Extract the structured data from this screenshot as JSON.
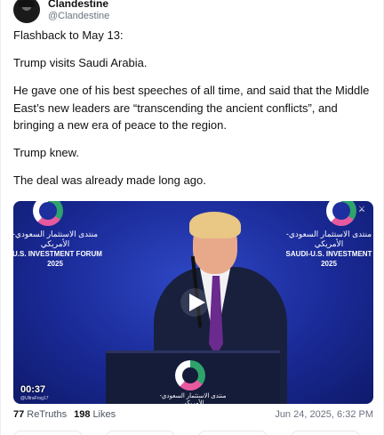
{
  "post": {
    "author": {
      "display_name": "Clandestine",
      "handle": "@Clandestine"
    },
    "paragraphs": [
      "Flashback to May 13:",
      "Trump visits Saudi Arabia.",
      "He gave one of his best speeches of all time, and said that the Middle East’s new leaders are “transcending the ancient conflicts”, and bringing a new era of peace to the region.",
      "Trump knew.",
      "The deal was already made long ago."
    ],
    "video": {
      "duration": "00:37",
      "watermark": "@UltraFrog17",
      "banner_left": {
        "arabic": "منتدى الاستثمار السعودي-الأمريكي",
        "line1": "I-U.S. INVESTMENT FORUM",
        "line2": "2025"
      },
      "banner_right": {
        "arabic": "منتدى الاستثمار السعودي-الأمريكي",
        "line1": "SAUDI-U.S. INVESTMENT",
        "line2": "2025"
      },
      "podium_text": "منتدى الاستثمار السعودي-الأمريكي",
      "play_icon": "play-icon"
    },
    "stats": {
      "retruths_count": "77",
      "retruths_label": "ReTruths",
      "likes_count": "198",
      "likes_label": "Likes",
      "timestamp": "Jun 24, 2025, 6:32 PM"
    }
  },
  "colors": {
    "video_bg": "#1a2a97",
    "tie": "#6a2a8e",
    "text": "#111111",
    "muted": "#6b7280"
  }
}
